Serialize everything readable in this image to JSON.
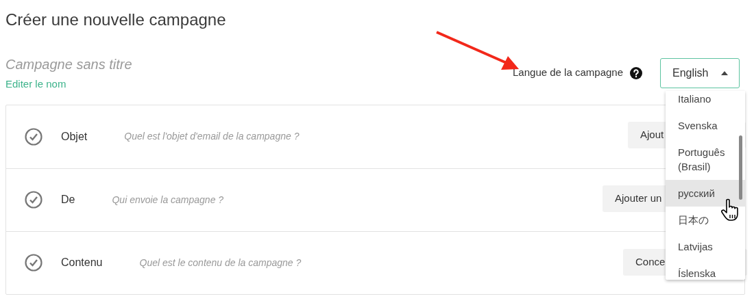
{
  "page_title": "Créer une nouvelle campagne",
  "campaign": {
    "name_placeholder": "Campagne sans titre",
    "edit_link": "Editer le nom"
  },
  "language": {
    "label": "Langue de la campagne",
    "value": "English",
    "expanded": true,
    "options": [
      {
        "label": "Italiano",
        "highlighted": false
      },
      {
        "label": "Svenska",
        "highlighted": false
      },
      {
        "label": "Português (Brasil)",
        "highlighted": false
      },
      {
        "label": "русский",
        "highlighted": true
      },
      {
        "label": "日本の",
        "highlighted": false
      },
      {
        "label": "Latvijas",
        "highlighted": false
      },
      {
        "label": "Íslenska",
        "highlighted": false
      }
    ]
  },
  "steps": [
    {
      "label": "Objet",
      "hint": "Quel est l'objet d'email de la campagne ?",
      "button": "Ajout"
    },
    {
      "label": "De",
      "hint": "Qui envoie la campagne ?",
      "button": "Ajouter un"
    },
    {
      "label": "Contenu",
      "hint": "Quel est le contenu de la campagne ?",
      "button": "Conce"
    }
  ]
}
